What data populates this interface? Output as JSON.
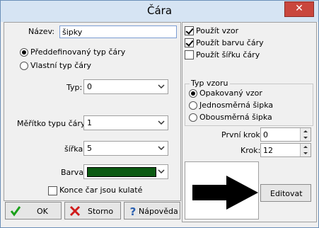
{
  "window": {
    "title": "Čára",
    "close_glyph": "✕"
  },
  "left": {
    "name_label": "Název:",
    "name_value": "šipky",
    "radio_predefined": "Předdefinovaný typ čáry",
    "radio_custom": "Vlastní typ čáry",
    "type_label": "Typ:",
    "type_value": "0",
    "scale_label": "Měřítko typu čáry:",
    "scale_value": "1",
    "width_label": "šířka:",
    "width_value": "5",
    "color_label": "Barva:",
    "color_value": "#0b5a12",
    "round_ends_label": "Konce čar jsou kulaté"
  },
  "buttons": {
    "ok": "OK",
    "cancel": "Storno",
    "help": "Nápověda",
    "edit": "Editovat"
  },
  "right": {
    "use_pattern": "Použít vzor",
    "use_color": "Použít barvu čáry",
    "use_width": "Použít šířku čáry",
    "pattern_group": "Typ vzoru",
    "pattern_repeated": "Opakovaný vzor",
    "pattern_one_arrow": "Jednosměrná šipka",
    "pattern_two_arrow": "Obousměrná šipka",
    "first_step_label": "První krok:",
    "first_step_value": "0",
    "step_label": "Krok:",
    "step_value": "12"
  },
  "colors": {
    "accent_border": "#7a9cd3",
    "swatch": "#0b5a12",
    "ok_check": "#1aa01a",
    "cancel_x": "#d01c1c",
    "help_q": "#2a5fb0"
  }
}
